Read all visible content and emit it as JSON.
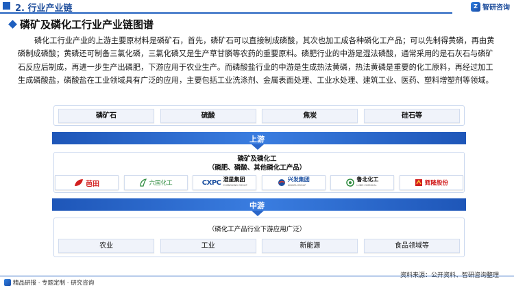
{
  "header": {
    "section": "2. 行业产业链",
    "brand_name": "智研咨询",
    "brand_logo_text": "Z"
  },
  "title": "磷矿及磷化工行业产业链图谱",
  "paragraph": "磷化工行业产业的上游主要原材料是磷矿石，首先，磷矿石可以直接制成磷酸，其次也加工成各种磷化工产品；可以先制得黄磷，再由黄磷制成磷酸；黄磷还可制备三氯化磷，三氯化磷又是生产草甘膦等农药的重要原料。磷肥行业的中游是湿法磷酸，通常采用的是石灰石与磷矿石反应后制成，再进一步生产出磷肥，下游应用于农业生产。而磷酸盐行业的中游是生成热法黄磷，热法黄磷是重要的化工原料，再经过加工生成磷酸盐，磷酸盐在工业领域具有广泛的应用，主要包括工业洗涤剂、金属表面处理、工业水处理、建筑工业、医药、塑料增塑剂等领域。",
  "upstream": {
    "items": [
      "磷矿石",
      "硫酸",
      "焦炭",
      "硅石等"
    ],
    "stage_label": "上游"
  },
  "midstream": {
    "caption_line1": "磷矿及磷化工",
    "caption_line2": "（磷肥、磷酸、其他磷化工产品）",
    "companies": [
      {
        "name": "芭田",
        "icon": "leaf-icon",
        "color": "#d21f1f"
      },
      {
        "name": "六国化工",
        "icon": "leaf-icon",
        "color": "#2a8a3c"
      },
      {
        "name": "澄星集团",
        "icon": "cxpc-logo",
        "color": "#1b4fa0",
        "sub": "CHENGXING GROUP"
      },
      {
        "name": "兴发集团",
        "icon": "globe-icon",
        "color": "#1b4fa0",
        "sub": "XINGFA GROUP"
      },
      {
        "name": "鲁北化工",
        "icon": "circle-logo",
        "color": "#2a8a3c",
        "sub": "LUBEI CHEMICAL"
      },
      {
        "name": "辉隆股份",
        "icon": "square-logo",
        "color": "#d21f1f"
      }
    ],
    "logo_prefix_cxpc": "CXPC",
    "stage_label": "中游"
  },
  "downstream": {
    "caption": "（磷化工产品行业下游应用广泛）",
    "items": [
      "农业",
      "工业",
      "新能源",
      "食品领域等"
    ]
  },
  "footer": {
    "left_text": "精品研报 · 专题定制 · 研究咨询",
    "source": "资料来源：公开资料、智研咨询整理"
  },
  "colors": {
    "primary": "#1f5fbf",
    "band_light": "#3a7de0"
  }
}
